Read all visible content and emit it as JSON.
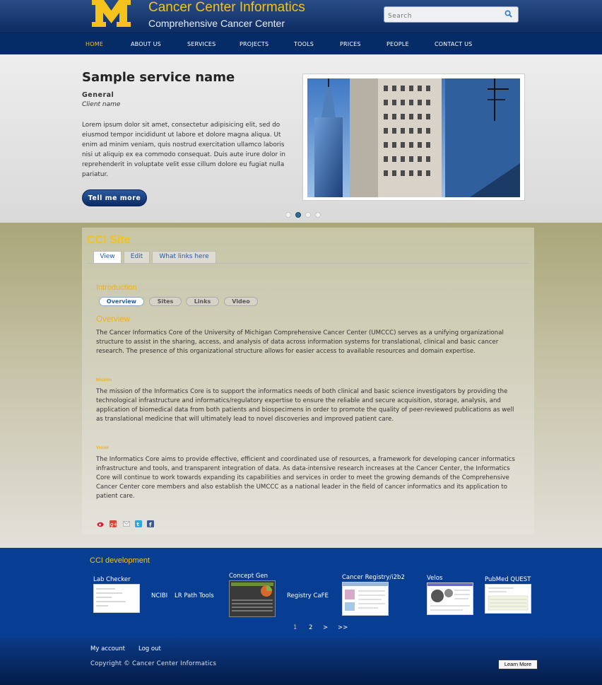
{
  "header": {
    "site_name": "Cancer Center Informatics",
    "slogan": "Comprehensive Cancer Center",
    "logo_letter": "M",
    "search_placeholder": "Search"
  },
  "nav": {
    "items": [
      "HOME",
      "ABOUT US",
      "SERVICES",
      "PROJECTS",
      "TOOLS",
      "PRICES",
      "PEOPLE",
      "CONTACT US"
    ],
    "active": "HOME"
  },
  "slider": {
    "title": "Sample service name",
    "category": "General",
    "client": "Client name",
    "text": "Lorem ipsum dolor sit amet, consectetur adipisicing elit, sed do eiusmod tempor incididunt ut labore et dolore magna aliqua. Ut enim ad minim veniam, quis nostrud exercitation ullamco laboris nisi ut aliquip ex ea commodo consequat. Duis aute irure dolor in reprehenderit in voluptate velit esse cillum dolore eu fugiat nulla pariatur.",
    "button": "Tell me more",
    "active_slide": 2,
    "slide_count": 4
  },
  "content": {
    "page_title": "CCI Site",
    "tabs": [
      "View",
      "Edit",
      "What links here"
    ],
    "intro_heading": "Introduction",
    "pills": [
      "Overview",
      "Sites",
      "Links",
      "Video"
    ],
    "overview_heading": "Overview",
    "overview_text": "The Cancer Informatics Core of the University of Michigan Comprehensive Cancer Center (UMCCC) serves as a unifying organizational structure to assist in the sharing, access, and analysis of data across information systems for translational, clinical and basic cancer research. The presence of this organizational structure allows for easier access to available resources and domain expertise.",
    "mission_heading": "Mission",
    "mission_text": "The mission of the Informatics Core is to support the informatics needs of both clinical and basic science investigators by providing the technological infrastructure and informatics/regulatory expertise to ensure the reliable and secure acquisition, storage, analysis, and application of biomedical data from both patients and biospecimens in order to promote the quality of peer-reviewed publications as well as translational medicine that will ultimately lead to novel discoveries and improved patient care.",
    "vision_heading": "Vision",
    "vision_text": "The Informatics Core aims to provide effective, efficient and coordinated use of resources, a framework for developing cancer informatics infrastructure and tools, and transparent integration of data. As data-intensive research increases at the Cancer Center, the Informatics Core will continue to work towards expanding its capabilities and services in order to meet the growing demands of the Comprehensive Cancer Center core members and also establish the UMCCC as a national leader in the field of cancer informatics and its application to patient care."
  },
  "share_icons": [
    "weibo-icon",
    "google-plus-icon",
    "email-icon",
    "twitter-icon",
    "facebook-icon"
  ],
  "dev": {
    "title": "CCI development",
    "items": [
      "Lab Checker",
      "NCIBI",
      "LR Path Tools",
      "Concept Gen",
      "Registry CaFE",
      "Cancer Registry/i2b2",
      "Velos",
      "PubMed QUEST"
    ],
    "pager": [
      "1",
      "2",
      ">",
      ">>"
    ]
  },
  "footer": {
    "links": [
      "My account",
      "Log out"
    ],
    "copyright": "Copyright © Cancer Center Informatics",
    "learn_more": "Learn More"
  },
  "colors": {
    "brand_blue": "#062c68",
    "brand_gold": "#f5c21b",
    "link_blue": "#245aa5"
  }
}
